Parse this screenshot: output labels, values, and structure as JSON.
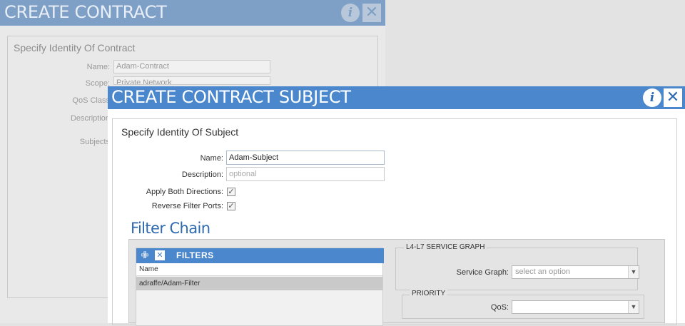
{
  "contract_dialog": {
    "title": "CREATE CONTRACT",
    "section_title": "Specify Identity Of Contract",
    "fields": {
      "name_label": "Name:",
      "name_value": "Adam-Contract",
      "scope_label": "Scope:",
      "scope_value": "Private Network",
      "qos_label": "QoS Class",
      "description_label": "Description",
      "subjects_label": "Subjects"
    }
  },
  "subject_dialog": {
    "title": "CREATE CONTRACT SUBJECT",
    "section_title": "Specify Identity Of Subject",
    "name_label": "Name:",
    "name_value": "Adam-Subject",
    "description_label": "Description:",
    "description_placeholder": "optional",
    "apply_both_label": "Apply Both Directions:",
    "apply_both_checked": true,
    "reverse_ports_label": "Reverse Filter Ports:",
    "reverse_ports_checked": true,
    "filter_chain_title": "Filter Chain",
    "filters": {
      "title": "FILTERS",
      "column_name": "Name",
      "rows": [
        "adraffe/Adam-Filter"
      ]
    },
    "service_graph": {
      "legend": "L4-L7 SERVICE GRAPH",
      "label": "Service Graph:",
      "placeholder": "select an option"
    },
    "priority": {
      "legend": "PRIORITY",
      "label": "QoS:",
      "value": ""
    }
  },
  "glyphs": {
    "info": "i",
    "close": "✕",
    "check": "✓",
    "dropdown": "▼",
    "add": "✙"
  },
  "colors": {
    "title_bar_active": "#4a87cd",
    "title_bar_inactive": "#7e9fc6",
    "accent_text": "#2e6ab0"
  }
}
